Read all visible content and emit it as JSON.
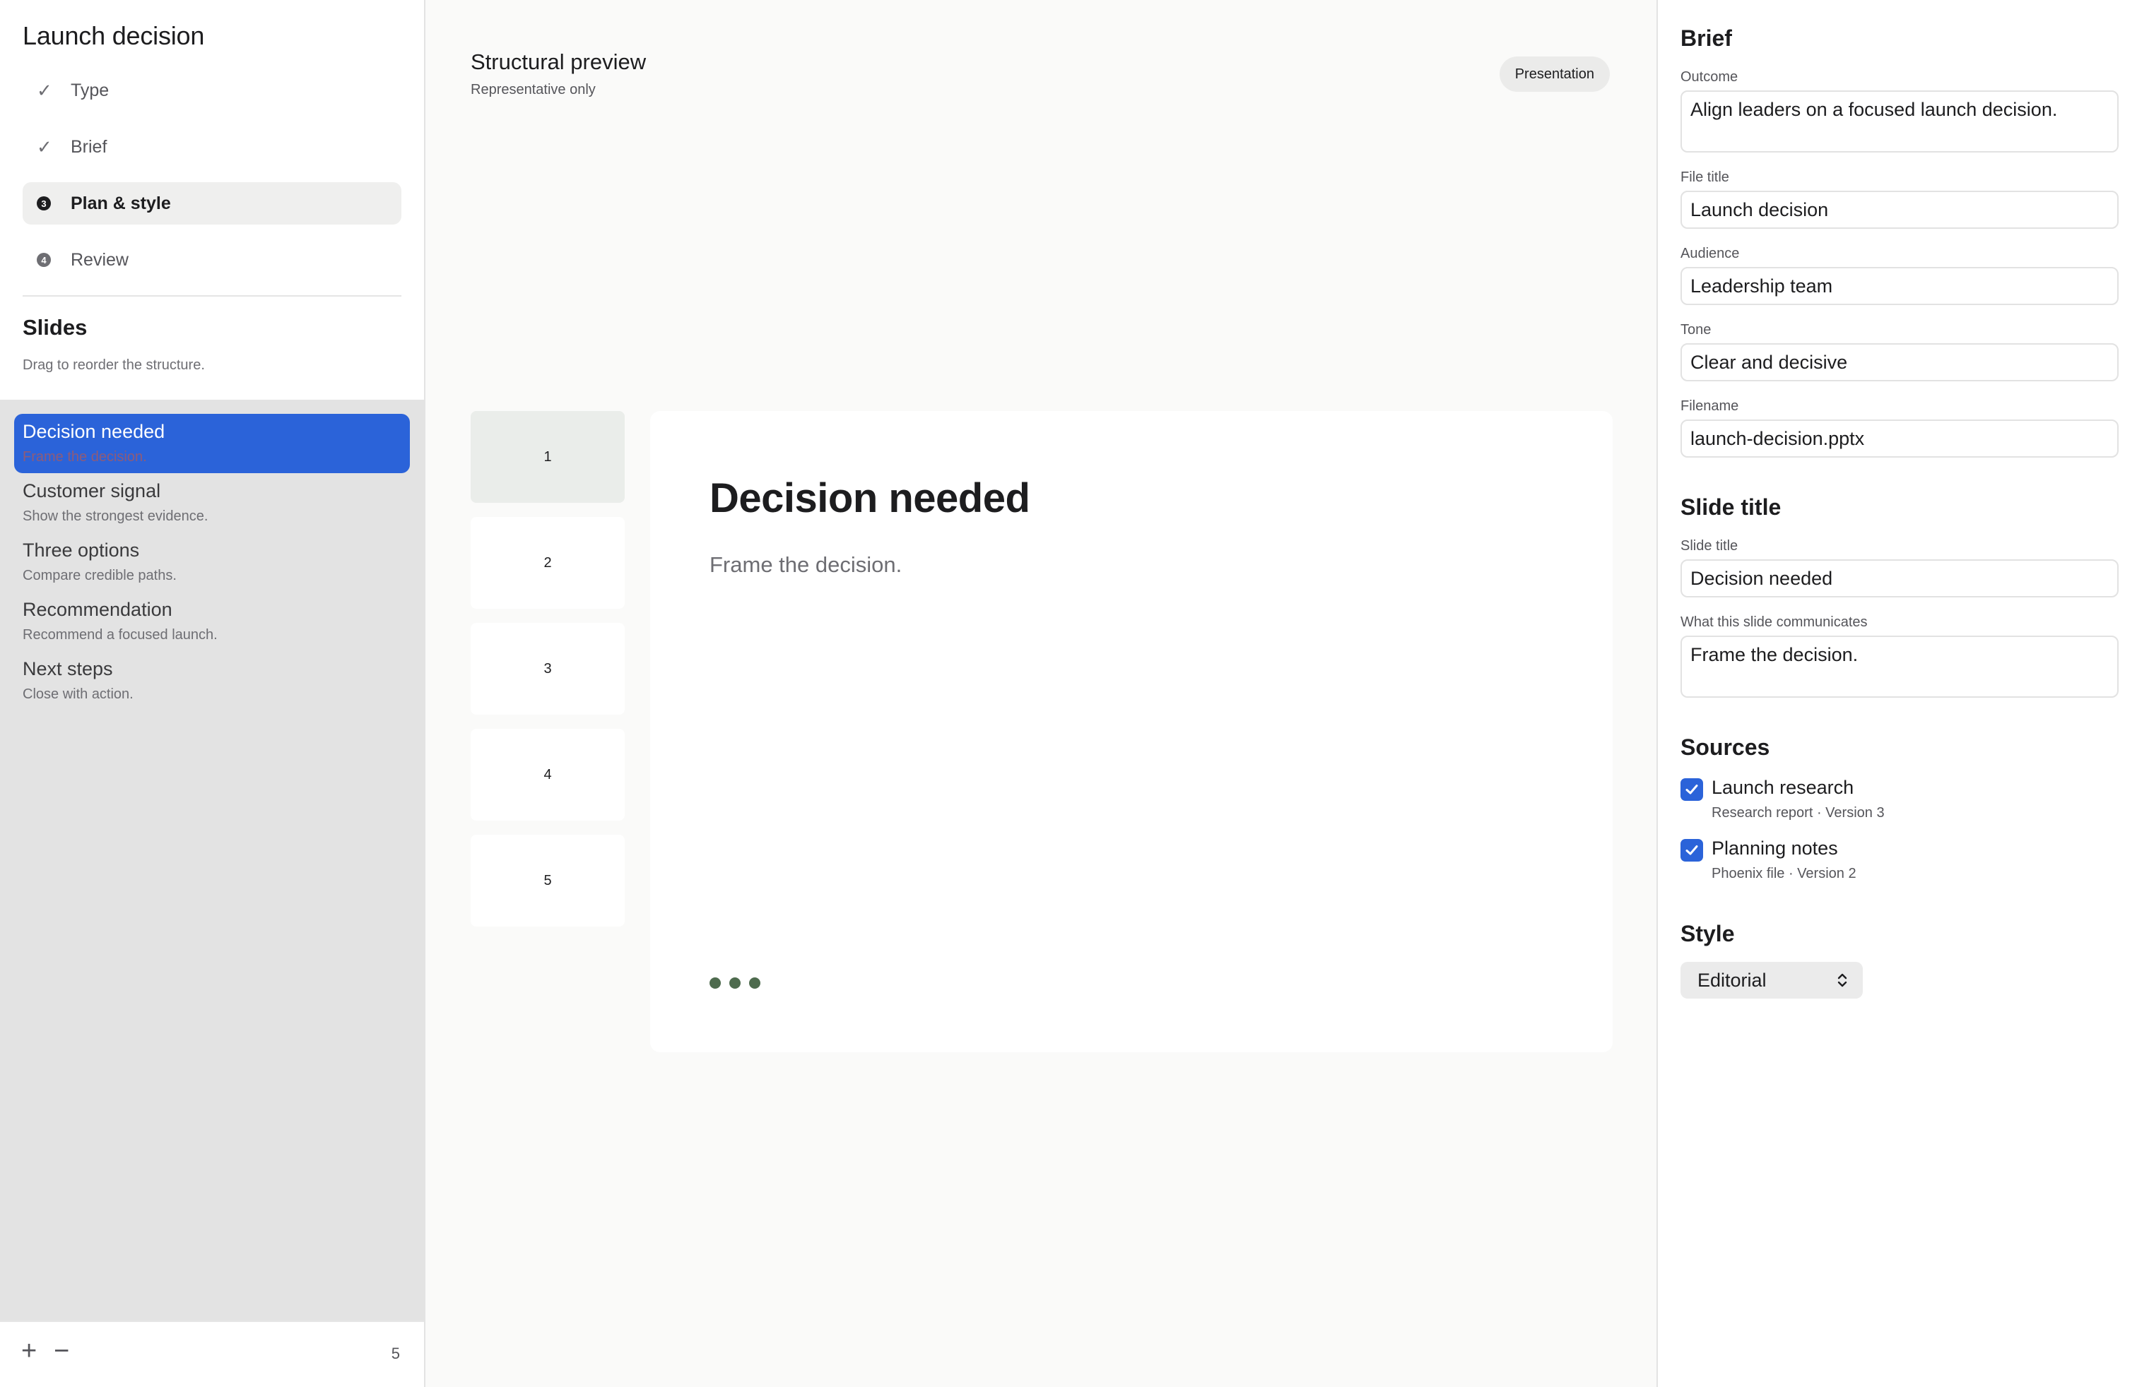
{
  "app": {
    "title": "Launch decision"
  },
  "steps": [
    {
      "label": "Type",
      "state": "done",
      "marker": "✓"
    },
    {
      "label": "Brief",
      "state": "done",
      "marker": "✓"
    },
    {
      "label": "Plan & style",
      "state": "active",
      "marker": "3"
    },
    {
      "label": "Review",
      "state": "pending",
      "marker": "4"
    }
  ],
  "slides_panel": {
    "heading": "Slides",
    "hint": "Drag to reorder the structure.",
    "items": [
      {
        "title": "Decision needed",
        "subtitle": "Frame the decision.",
        "selected": true
      },
      {
        "title": "Customer signal",
        "subtitle": "Show the strongest evidence."
      },
      {
        "title": "Three options",
        "subtitle": "Compare credible paths."
      },
      {
        "title": "Recommendation",
        "subtitle": "Recommend a focused launch."
      },
      {
        "title": "Next steps",
        "subtitle": "Close with action."
      }
    ],
    "footer": {
      "add_label": "+",
      "remove_label": "−",
      "count": "5"
    }
  },
  "preview": {
    "title": "Structural preview",
    "subtitle": "Representative only",
    "badge": "Presentation",
    "thumbnails": [
      "1",
      "2",
      "3",
      "4",
      "5"
    ],
    "active_thumbnail": "1",
    "canvas": {
      "heading": "Decision needed",
      "body": "Frame the decision."
    }
  },
  "brief": {
    "heading": "Brief",
    "outcome_label": "Outcome",
    "outcome_value": "Align leaders on a focused launch decision.",
    "file_title_label": "File title",
    "file_title_value": "Launch decision",
    "audience_label": "Audience",
    "audience_value": "Leadership team",
    "tone_label": "Tone",
    "tone_value": "Clear and decisive",
    "filename_label": "Filename",
    "filename_value": "launch-decision.pptx"
  },
  "slide_title": {
    "heading": "Slide title",
    "title_label": "Slide title",
    "title_value": "Decision needed",
    "communicates_label": "What this slide communicates",
    "communicates_value": "Frame the decision."
  },
  "sources": {
    "heading": "Sources",
    "items": [
      {
        "name": "Launch research",
        "meta": "Research report · Version 3",
        "checked": true
      },
      {
        "name": "Planning notes",
        "meta": "Phoenix file · Version 2",
        "checked": true
      }
    ]
  },
  "style": {
    "heading": "Style",
    "selected": "Editorial"
  },
  "colors": {
    "accent": "#2b63d9",
    "dots": "#4e6b4e",
    "sidebar_list_bg": "#e3e3e3"
  }
}
